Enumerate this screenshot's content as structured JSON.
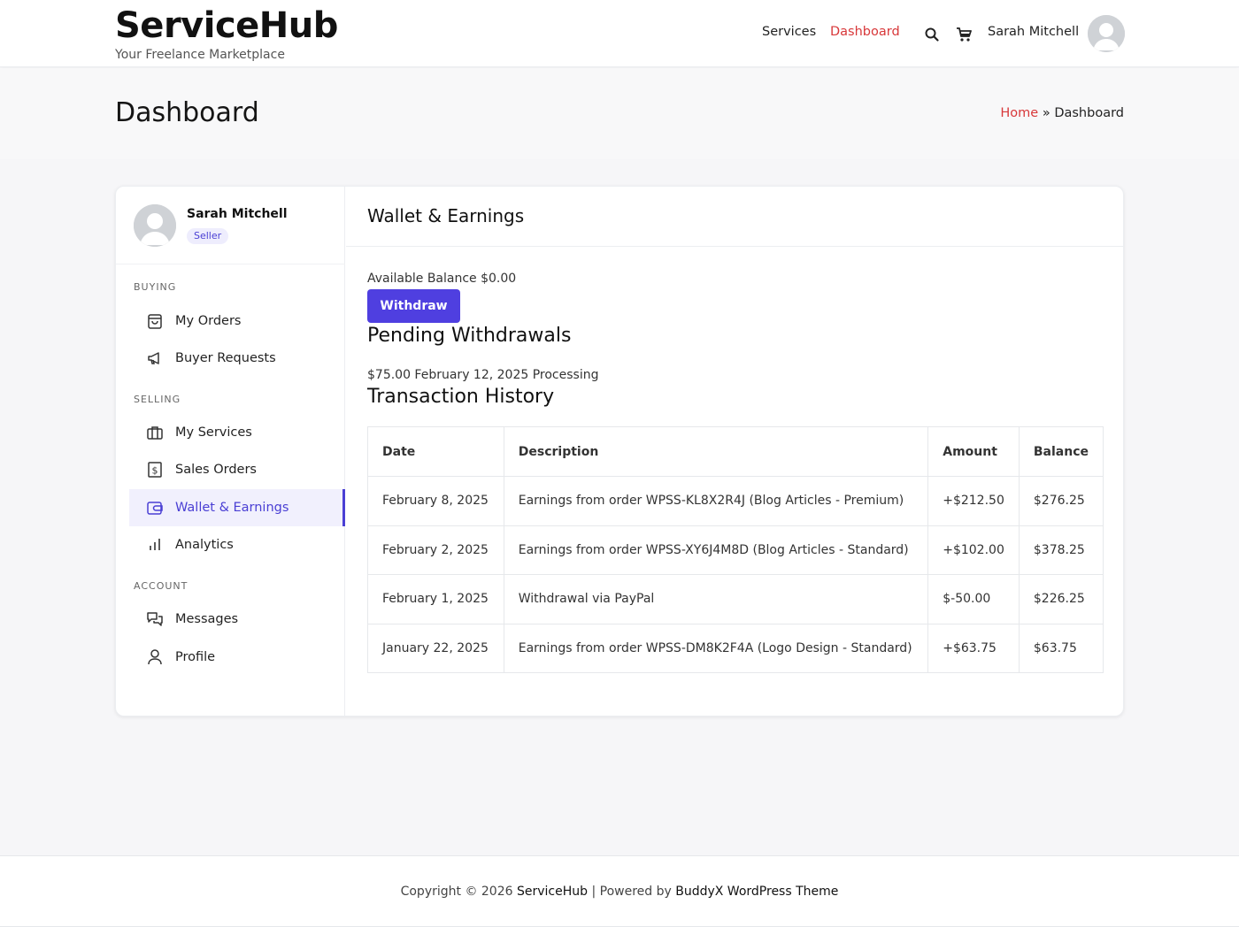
{
  "header": {
    "brand_title": "ServiceHub",
    "brand_tagline": "Your Freelance Marketplace",
    "nav": [
      {
        "label": "Services"
      },
      {
        "label": "Dashboard",
        "active": true
      }
    ],
    "user_name": "Sarah Mitchell"
  },
  "page": {
    "title": "Dashboard",
    "breadcrumb": {
      "home": "Home",
      "separator": " » ",
      "current": "Dashboard"
    }
  },
  "sidebar": {
    "profile": {
      "name": "Sarah Mitchell",
      "role": "Seller"
    },
    "sections": [
      {
        "title": "BUYING",
        "items": [
          {
            "label": "My Orders",
            "icon": "shopping-bag-icon"
          },
          {
            "label": "Buyer Requests",
            "icon": "megaphone-icon"
          }
        ]
      },
      {
        "title": "SELLING",
        "items": [
          {
            "label": "My Services",
            "icon": "briefcase-icon"
          },
          {
            "label": "Sales Orders",
            "icon": "receipt-dollar-icon"
          },
          {
            "label": "Wallet & Earnings",
            "icon": "wallet-icon",
            "active": true
          },
          {
            "label": "Analytics",
            "icon": "bar-chart-icon"
          }
        ]
      },
      {
        "title": "ACCOUNT",
        "items": [
          {
            "label": "Messages",
            "icon": "chat-bubbles-icon"
          },
          {
            "label": "Profile",
            "icon": "user-icon"
          }
        ]
      }
    ]
  },
  "wallet": {
    "title": "Wallet & Earnings",
    "available_balance": "Available Balance $0.00",
    "withdraw_label": "Withdraw",
    "pending_title": "Pending Withdrawals",
    "pending_row": "$75.00 February 12, 2025 Processing",
    "history_title": "Transaction History",
    "columns": [
      "Date",
      "Description",
      "Amount",
      "Balance"
    ],
    "rows": [
      {
        "date": "February 8, 2025",
        "description": "Earnings from order WPSS-KL8X2R4J (Blog Articles - Premium)",
        "amount": "+$212.50",
        "balance": "$276.25"
      },
      {
        "date": "February 2, 2025",
        "description": "Earnings from order WPSS-XY6J4M8D (Blog Articles - Standard)",
        "amount": "+$102.00",
        "balance": "$378.25"
      },
      {
        "date": "February 1, 2025",
        "description": "Withdrawal via PayPal",
        "amount": "$-50.00",
        "balance": "$226.25"
      },
      {
        "date": "January 22, 2025",
        "description": "Earnings from order WPSS-DM8K2F4A (Logo Design - Standard)",
        "amount": "+$63.75",
        "balance": "$63.75"
      }
    ]
  },
  "footer": {
    "prefix": "Copyright © 2026 ",
    "site": "ServiceHub",
    "middle": " | Powered by ",
    "theme": "BuddyX WordPress Theme"
  },
  "colors": {
    "accent": "#4f3fe0",
    "link_red": "#d8383a"
  }
}
